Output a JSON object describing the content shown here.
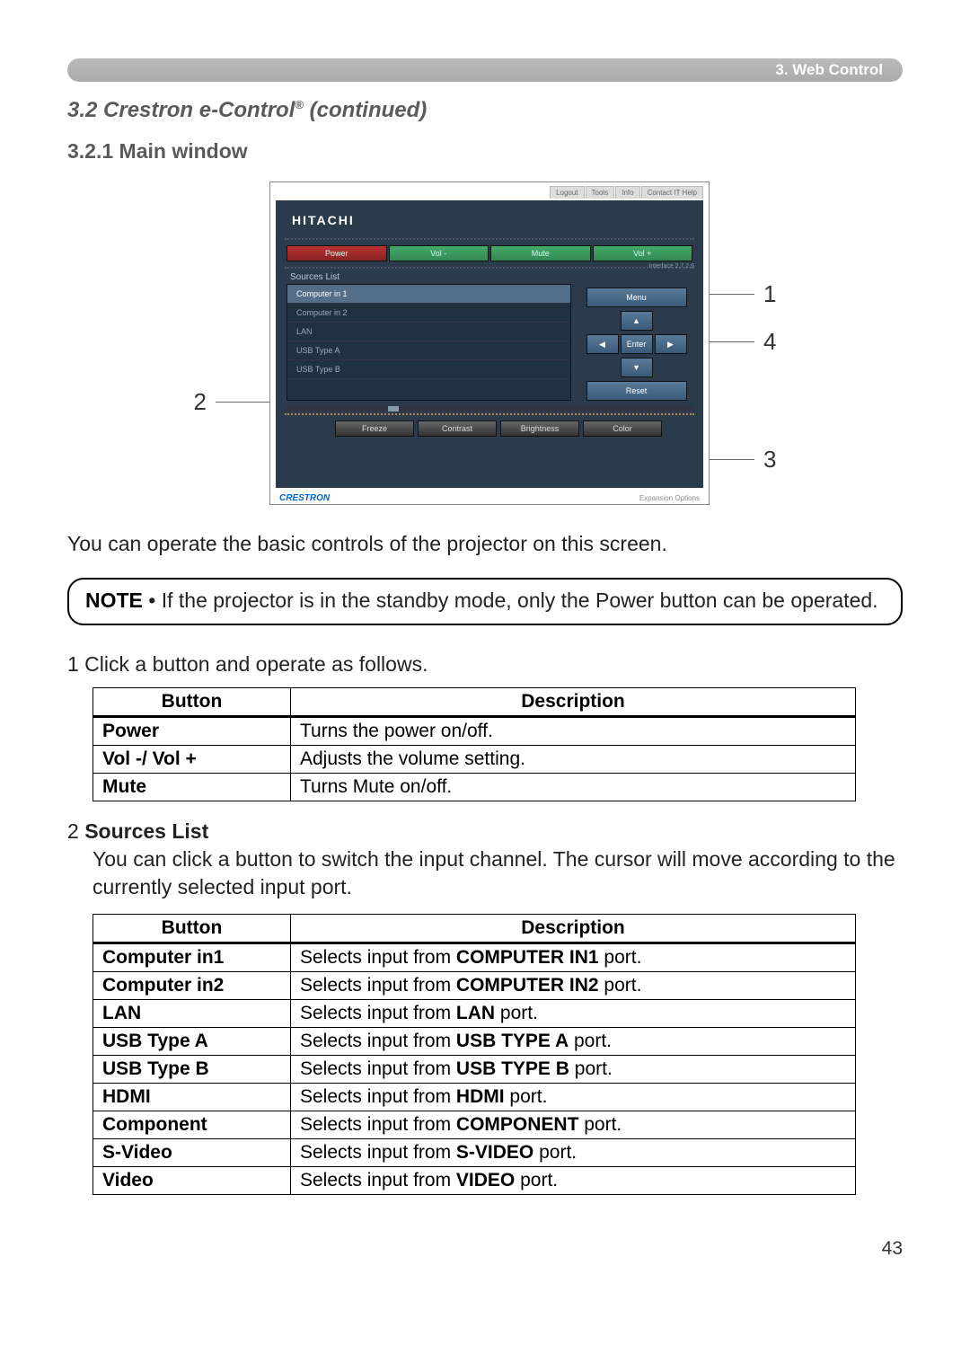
{
  "header": {
    "chapter": "3. Web Control"
  },
  "section_title": {
    "num_prefix": "3.2 Crestron e-Control",
    "suffix": " (continued)"
  },
  "subsection_title": "3.2.1 Main window",
  "callouts": {
    "c1": "1",
    "c2": "2",
    "c3": "3",
    "c4": "4"
  },
  "ui": {
    "tabs": [
      "Logout",
      "Tools",
      "Info",
      "Contact IT Help"
    ],
    "logo": "HITACHI",
    "interface": "Interface 2.7.2.6",
    "top_buttons": {
      "power": "Power",
      "vol_down": "Vol -",
      "mute": "Mute",
      "vol_up": "Vol +"
    },
    "sources_label": "Sources List",
    "sources": [
      "Computer in 1",
      "Computer in 2",
      "LAN",
      "USB Type A",
      "USB Type B"
    ],
    "nav": {
      "menu": "Menu",
      "enter": "Enter",
      "reset": "Reset"
    },
    "bottom_buttons": [
      "Freeze",
      "Contrast",
      "Brightness",
      "Color"
    ],
    "footer": {
      "brand": "CRESTRON",
      "opts": "Expansion Options"
    }
  },
  "intro_text": "You can operate the basic controls of the projector on this screen.",
  "note": {
    "label": "NOTE",
    "text": " • If the projector is in the standby mode, only the Power button can be operated."
  },
  "step1_text": "1 Click a button and operate as follows.",
  "table1": {
    "headers": [
      "Button",
      "Description"
    ],
    "rows": [
      {
        "button": "Power",
        "desc": "Turns the power on/off."
      },
      {
        "button": "Vol -/ Vol +",
        "desc": "Adjusts the volume setting."
      },
      {
        "button": "Mute",
        "desc": "Turns Mute on/off."
      }
    ]
  },
  "sources_section": {
    "num": "2 ",
    "title": "Sources List",
    "desc": "You can click a button to switch the input channel. The cursor will move according to the currently selected input port."
  },
  "table2": {
    "headers": [
      "Button",
      "Description"
    ],
    "rows": [
      {
        "button": "Computer in1",
        "pre": "Selects input from ",
        "bold": "COMPUTER IN1",
        "post": " port."
      },
      {
        "button": "Computer in2",
        "pre": "Selects input from ",
        "bold": "COMPUTER IN2",
        "post": " port."
      },
      {
        "button": "LAN",
        "pre": "Selects input from ",
        "bold": "LAN",
        "post": " port."
      },
      {
        "button": "USB Type A",
        "pre": "Selects input from ",
        "bold": "USB TYPE A",
        "post": " port."
      },
      {
        "button": "USB Type B",
        "pre": "Selects input from ",
        "bold": "USB TYPE B",
        "post": " port."
      },
      {
        "button": "HDMI",
        "pre": "Selects input from ",
        "bold": "HDMI",
        "post": " port."
      },
      {
        "button": "Component",
        "pre": "Selects input from ",
        "bold": "COMPONENT",
        "post": " port."
      },
      {
        "button": "S-Video",
        "pre": "Selects input from ",
        "bold": "S-VIDEO",
        "post": " port."
      },
      {
        "button": "Video",
        "pre": "Selects input from ",
        "bold": "VIDEO",
        "post": " port."
      }
    ]
  },
  "page_number": "43"
}
